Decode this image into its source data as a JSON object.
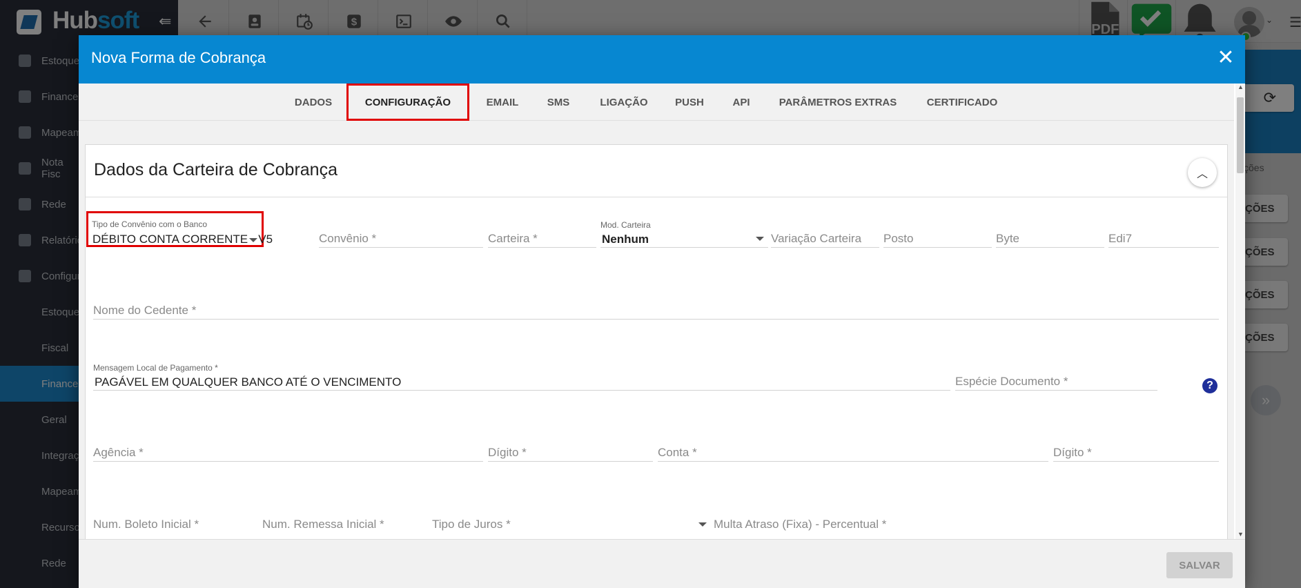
{
  "app": {
    "brand_prefix": "Hub",
    "brand_suffix": "soft",
    "icon_names": [
      "back-arrow-icon",
      "contact-card-icon",
      "calendar-clock-icon",
      "dollar-icon",
      "terminal-icon",
      "eye-icon",
      "search-icon",
      "pdf-icon",
      "check-message-icon",
      "bell-icon"
    ],
    "accent_color": "#0787d1"
  },
  "sidebar": {
    "items": [
      {
        "label": "Estoque"
      },
      {
        "label": "Financei"
      },
      {
        "label": "Mapeam"
      },
      {
        "label": "Nota Fisc"
      },
      {
        "label": "Rede"
      },
      {
        "label": "Relatório"
      },
      {
        "label": "Configur"
      },
      {
        "label": "Estoque"
      },
      {
        "label": "Fiscal"
      },
      {
        "label": "Financei"
      },
      {
        "label": "Geral"
      },
      {
        "label": "Integraçõ"
      },
      {
        "label": "Mapeam"
      },
      {
        "label": "Recursos"
      },
      {
        "label": "Rede"
      }
    ]
  },
  "background": {
    "column_label": "ções",
    "buttons": [
      "ÇÕES",
      "ÇÕES",
      "ÇÕES",
      "ÇÕES"
    ]
  },
  "modal": {
    "title": "Nova Forma de Cobrança",
    "tabs": [
      "DADOS",
      "CONFIGURAÇÃO",
      "EMAIL",
      "SMS",
      "LIGAÇÃO",
      "PUSH",
      "API",
      "PARÂMETROS EXTRAS",
      "CERTIFICADO"
    ],
    "active_tab": "CONFIGURAÇÃO",
    "section_title": "Dados da Carteira de Cobrança",
    "fields": {
      "tipo_convenio": {
        "label": "Tipo de Convênio com o Banco",
        "value": "DÉBITO CONTA CORRENTE - V5"
      },
      "convenio": {
        "label": "Convênio *"
      },
      "carteira": {
        "label": "Carteira *"
      },
      "mod_carteira": {
        "label": "Mod. Carteira",
        "value": "Nenhum"
      },
      "variacao_carteira": {
        "label": "Variação Carteira"
      },
      "posto": {
        "label": "Posto"
      },
      "byte": {
        "label": "Byte"
      },
      "edi7": {
        "label": "Edi7"
      },
      "nome_cedente": {
        "label": "Nome do Cedente *"
      },
      "mensagem_local": {
        "label": "Mensagem Local de Pagamento *",
        "value": "PAGÁVEL EM QUALQUER BANCO ATÉ O VENCIMENTO"
      },
      "especie_documento": {
        "label": "Espécie Documento *"
      },
      "agencia": {
        "label": "Agência *"
      },
      "digito_agencia": {
        "label": "Dígito *"
      },
      "conta": {
        "label": "Conta *"
      },
      "digito_conta": {
        "label": "Dígito *"
      },
      "num_boleto": {
        "label": "Num. Boleto Inicial *"
      },
      "num_remessa": {
        "label": "Num. Remessa Inicial *"
      },
      "tipo_juros": {
        "label": "Tipo de Juros *"
      },
      "multa_atraso": {
        "label": "Multa Atraso (Fixa) - Percentual *"
      }
    },
    "save_label": "SALVAR"
  }
}
